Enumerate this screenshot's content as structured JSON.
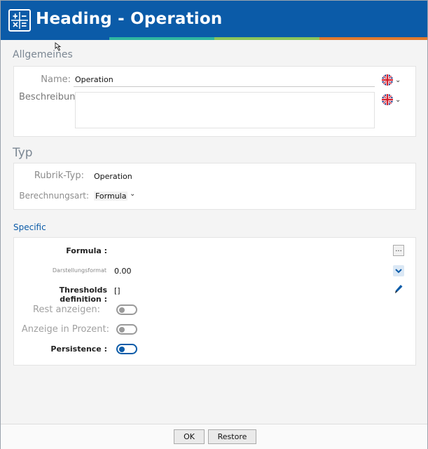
{
  "window": {
    "title": "Heading - Operation",
    "icon": "calculator-icon"
  },
  "allgemeines": {
    "section_title": "Allgemeines",
    "name_label": "Name:",
    "name_value": "Operation",
    "beschreibung_label": "Beschreibung:",
    "beschreibung_value": "",
    "language_icon": "uk-flag-icon"
  },
  "typ": {
    "section_title": "Typ",
    "rubrik_label": "Rubrik-Typ:",
    "rubrik_value": "Operation",
    "berechnung_label": "Berechnungsart:",
    "berechnung_value": "Formula"
  },
  "specific": {
    "section_title": "Specific",
    "formula_label": "Formula :",
    "formula_button": "...",
    "darstellung_label": "Darstellungsformat",
    "darstellung_value": "0.00",
    "thresholds_label": "Thresholds definition :",
    "thresholds_value": "[]",
    "rest_label": "Rest anzeigen:",
    "rest_on": false,
    "prozent_label": "Anzeige in Prozent:",
    "prozent_on": false,
    "persistence_label": "Persistence :",
    "persistence_on": true
  },
  "footer": {
    "ok_label": "OK",
    "restore_label": "Restore"
  },
  "colors": {
    "title_bar": "#0b5ba8",
    "stripe_teal": "#2fb6a0",
    "stripe_green": "#8cc55a",
    "stripe_orange": "#e07a2e",
    "section_blue": "#0b5ba8"
  }
}
